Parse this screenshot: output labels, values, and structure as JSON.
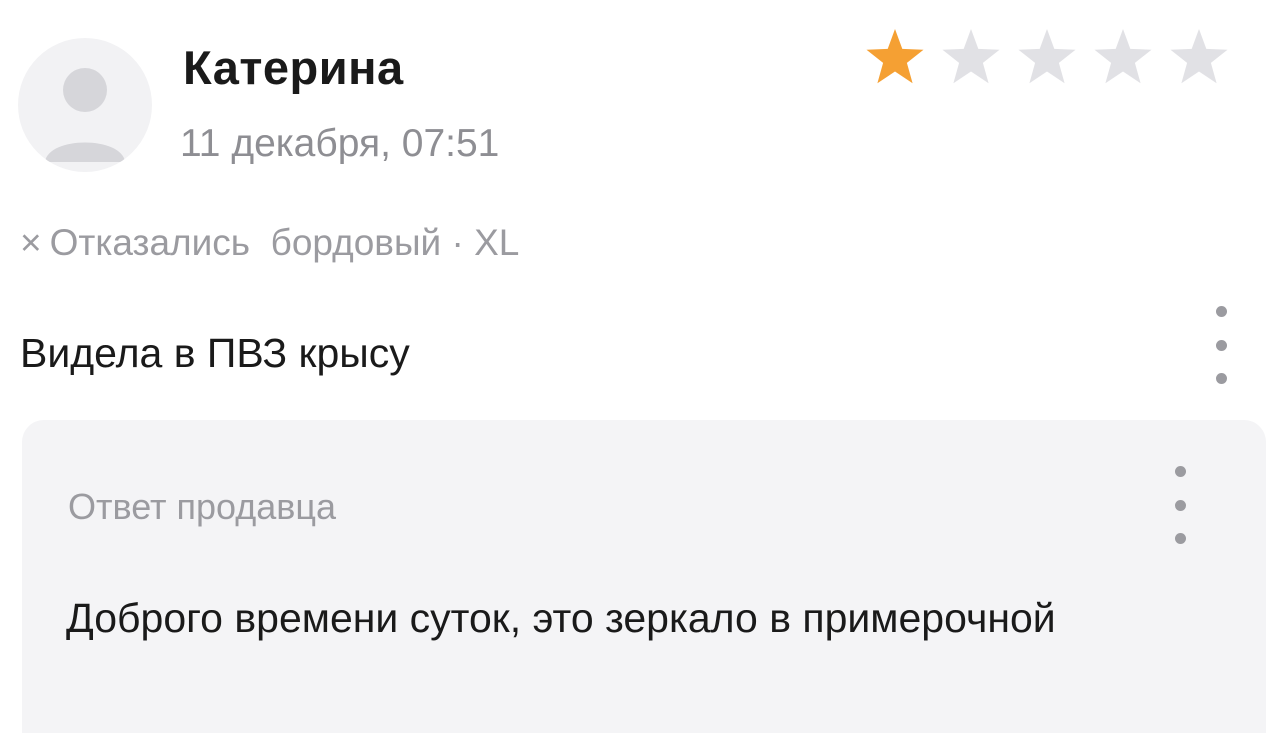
{
  "review": {
    "author": "Катерина",
    "date": "11 декабря, 07:51",
    "rating": 1,
    "rating_max": 5,
    "variant": {
      "status": "Отказались",
      "color_size": "бордовый · XL"
    },
    "text": "Видела в ПВЗ крысу",
    "icons": {
      "avatar": "default-user-avatar-icon",
      "star": "star-icon",
      "refused": "close-icon",
      "more": "vertical-dots-icon"
    }
  },
  "seller_reply": {
    "title": "Ответ продавца",
    "text": "Доброго времени суток, это зеркало в примерочной"
  },
  "colors": {
    "star_filled": "#f5a033",
    "star_empty": "#e1e1e5",
    "muted_text": "#8e8e93",
    "reply_background": "#f4f4f6"
  }
}
